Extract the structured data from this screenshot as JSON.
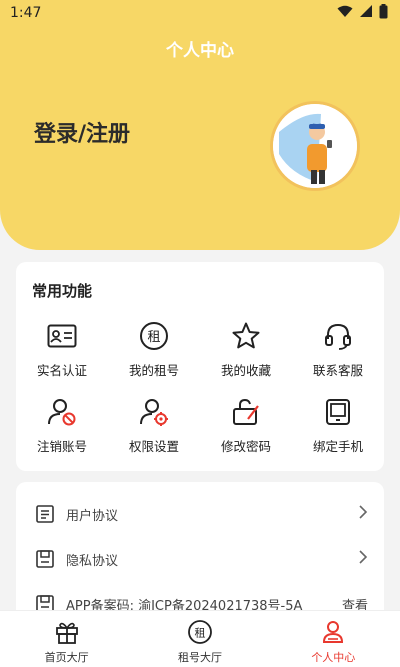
{
  "status": {
    "time": "1:47"
  },
  "header": {
    "title": "个人中心",
    "login_text": "登录/注册"
  },
  "functions": {
    "title": "常用功能",
    "items": [
      {
        "label": "实名认证",
        "icon": "id-card-icon"
      },
      {
        "label": "我的租号",
        "icon": "rent-icon"
      },
      {
        "label": "我的收藏",
        "icon": "star-icon"
      },
      {
        "label": "联系客服",
        "icon": "headset-icon"
      },
      {
        "label": "注销账号",
        "icon": "user-cancel-icon"
      },
      {
        "label": "权限设置",
        "icon": "user-settings-icon"
      },
      {
        "label": "修改密码",
        "icon": "lock-edit-icon"
      },
      {
        "label": "绑定手机",
        "icon": "tablet-icon"
      }
    ]
  },
  "list": {
    "user_agreement": "用户协议",
    "privacy_agreement": "隐私协议",
    "icp_label": "APP备案码: 渝ICP备2024021738号-5A",
    "icp_action": "查看"
  },
  "tabs": [
    {
      "label": "首页大厅",
      "icon": "gift-icon"
    },
    {
      "label": "租号大厅",
      "icon": "rent-icon"
    },
    {
      "label": "个人中心",
      "icon": "user-icon",
      "active": true
    }
  ],
  "colors": {
    "brand_yellow": "#f7d766",
    "active_red": "#e8382e"
  }
}
